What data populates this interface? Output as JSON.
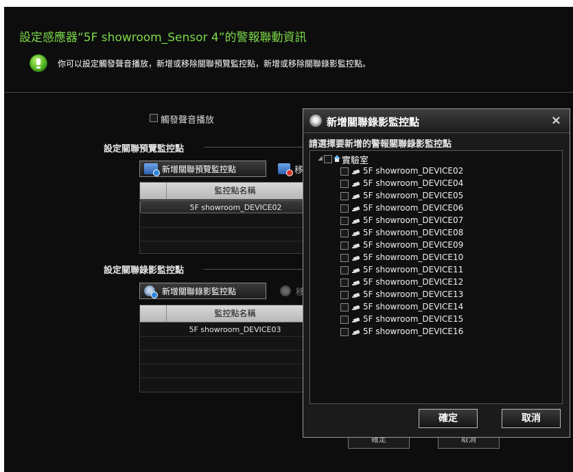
{
  "header": {
    "title": "設定感應器“5F showroom_Sensor 4”的警報聯動資訊",
    "hint": "你可以設定觸發聲音播放，新增或移除關聯預覽監控點，新增或移除關聯錄影監控點。"
  },
  "sound": {
    "label": "觸發聲音播放",
    "checked": false
  },
  "preview_section": {
    "label": "設定關聯預覽監控點",
    "add_button": "新增關聯預覽監控點",
    "remove_button_partial": "移",
    "column_header": "監控點名稱",
    "rows": [
      "5F showroom_DEVICE02"
    ]
  },
  "record_section": {
    "label": "設定關聯錄影監控點",
    "add_button": "新增關聯錄影監控點",
    "remove_button_partial": "移",
    "column_header": "監控點名稱",
    "rows": [
      "5F showroom_DEVICE03"
    ]
  },
  "bottom_buttons": {
    "ok_partial": "確定",
    "cancel_partial": "取消"
  },
  "dialog": {
    "title": "新增關聯錄影監控點",
    "close": "×",
    "prompt": "請選擇要新增的警報關聯錄影監控點",
    "tree": {
      "root_label": "實驗室",
      "expander": "◢",
      "items": [
        "5F showroom_DEVICE02",
        "5F showroom_DEVICE04",
        "5F showroom_DEVICE05",
        "5F showroom_DEVICE06",
        "5F showroom_DEVICE07",
        "5F showroom_DEVICE08",
        "5F showroom_DEVICE09",
        "5F showroom_DEVICE10",
        "5F showroom_DEVICE11",
        "5F showroom_DEVICE12",
        "5F showroom_DEVICE13",
        "5F showroom_DEVICE14",
        "5F showroom_DEVICE15",
        "5F showroom_DEVICE16"
      ]
    },
    "ok_button": "確定",
    "cancel_button": "取消"
  },
  "colors": {
    "title_green": "#7dd94a",
    "background": "#0d0d0d",
    "header_gray": "#c8c8c8"
  }
}
